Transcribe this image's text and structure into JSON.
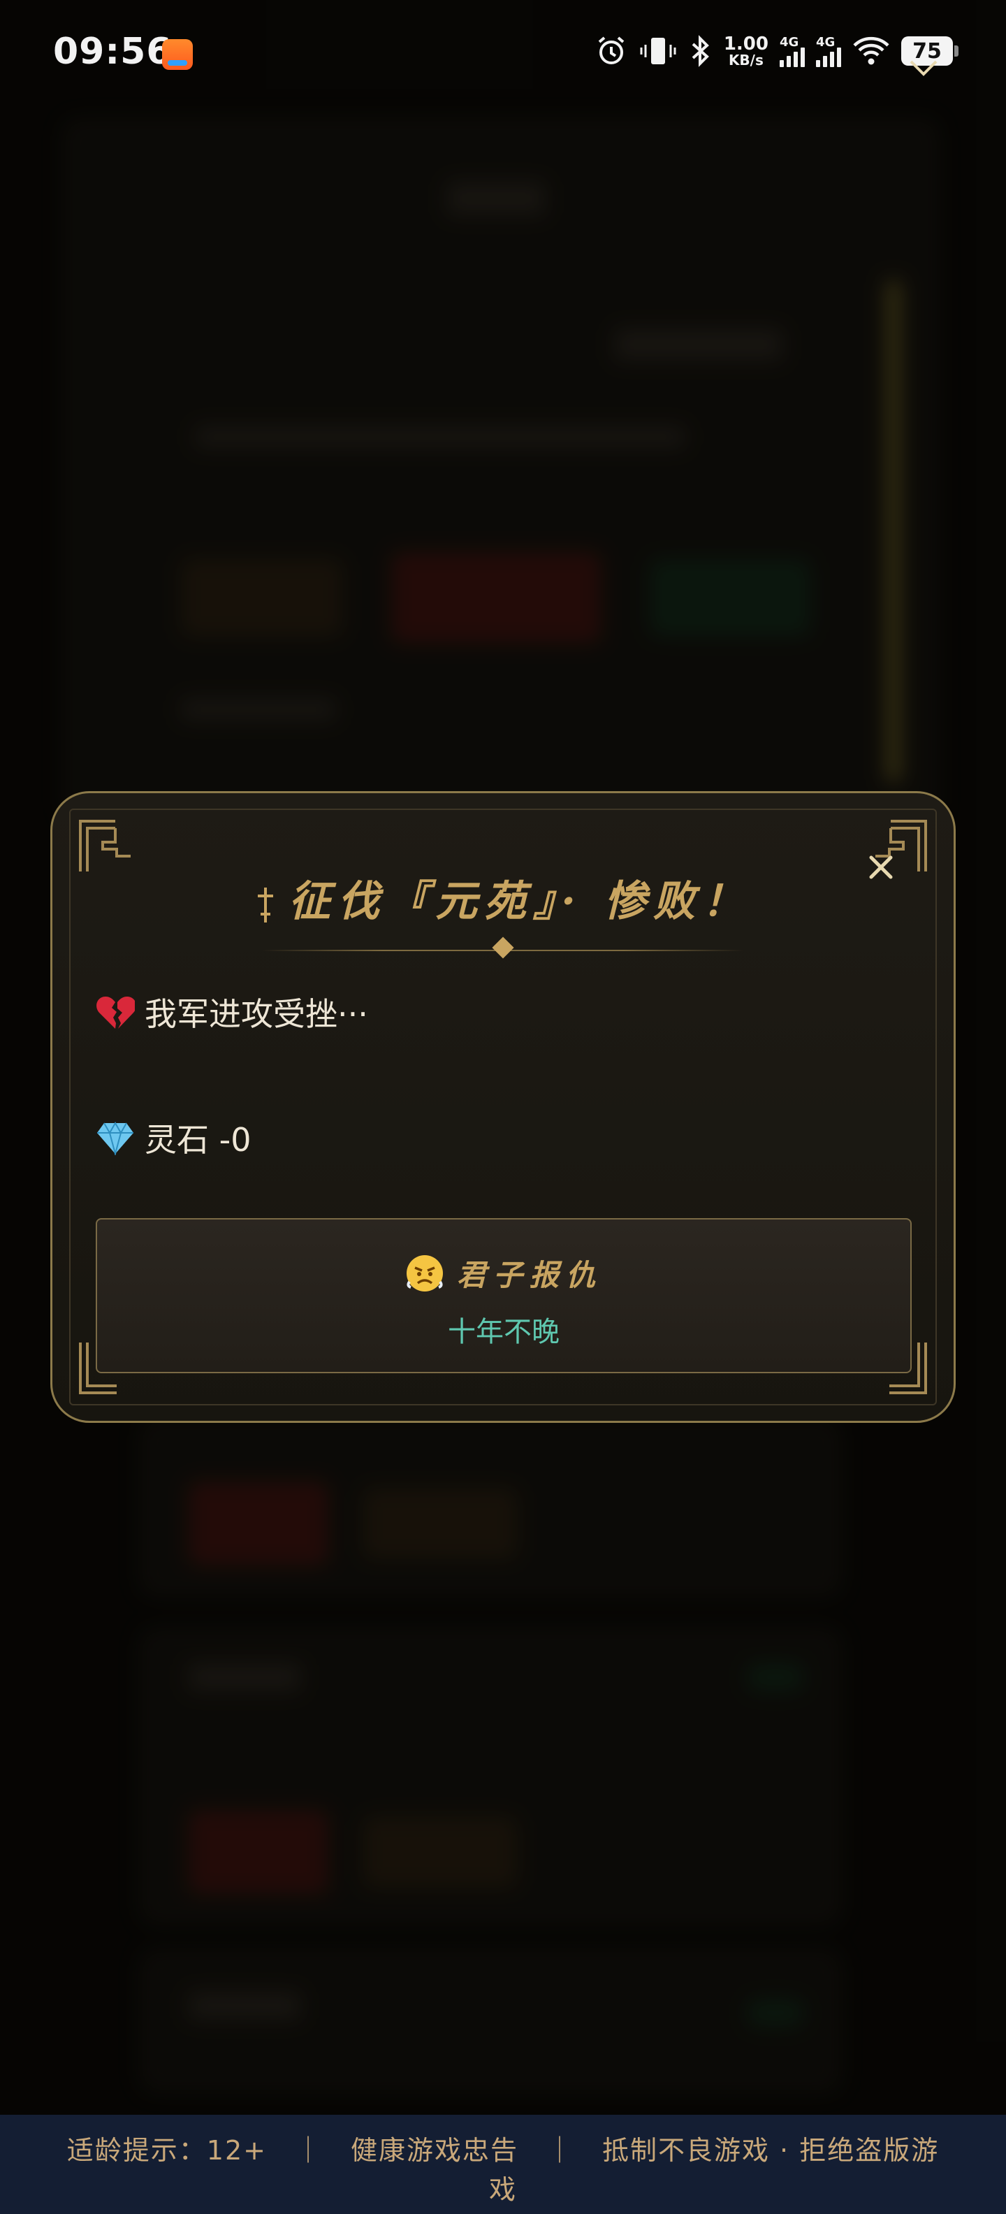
{
  "status_bar": {
    "time": "09:56",
    "net_speed_value": "1.00",
    "net_speed_unit": "KB/s",
    "signal_1_label": "4G",
    "signal_2_label": "4G",
    "battery": "75"
  },
  "modal": {
    "title": "征伐『元苑』· 惨败！",
    "message": "我军进攻受挫···",
    "reward": "灵石 -0",
    "action": {
      "label": "君子报仇",
      "sublabel": "十年不晚"
    },
    "colors": {
      "gold": "#c9a561",
      "teal": "#5fc8b0",
      "border": "#8c7a4a"
    }
  },
  "footer": {
    "line1": "适龄提示：12+　｜　健康游戏忠告　｜　抵制不良游戏 · 拒绝盗版游",
    "line2": "戏"
  }
}
